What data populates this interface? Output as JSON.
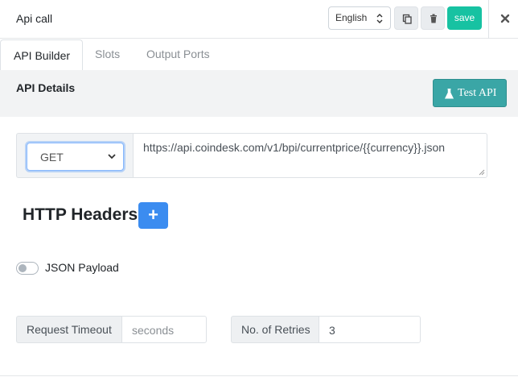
{
  "header": {
    "title": "Api call",
    "language": "English",
    "save_label": "save",
    "icons": [
      "copy-icon",
      "trash-icon",
      "close-icon"
    ]
  },
  "tabs": [
    {
      "label": "API Builder",
      "active": true
    },
    {
      "label": "Slots",
      "active": false
    },
    {
      "label": "Output Ports",
      "active": false
    }
  ],
  "api_details": {
    "title": "API Details",
    "test_label": "Test API",
    "method": "GET",
    "url": "https://api.coindesk.com/v1/bpi/currentprice/{{currency}}.json"
  },
  "http_headers": {
    "title": "HTTP Headers",
    "add_label": "+"
  },
  "json_payload": {
    "label": "JSON Payload",
    "enabled": false
  },
  "request_timeout": {
    "label": "Request Timeout",
    "value": "",
    "placeholder": "seconds"
  },
  "retries": {
    "label": "No. of Retries",
    "value": "3"
  },
  "colors": {
    "save": "#17c2a2",
    "test_api": "#3aa6a6",
    "add_header": "#3b8cf0"
  }
}
